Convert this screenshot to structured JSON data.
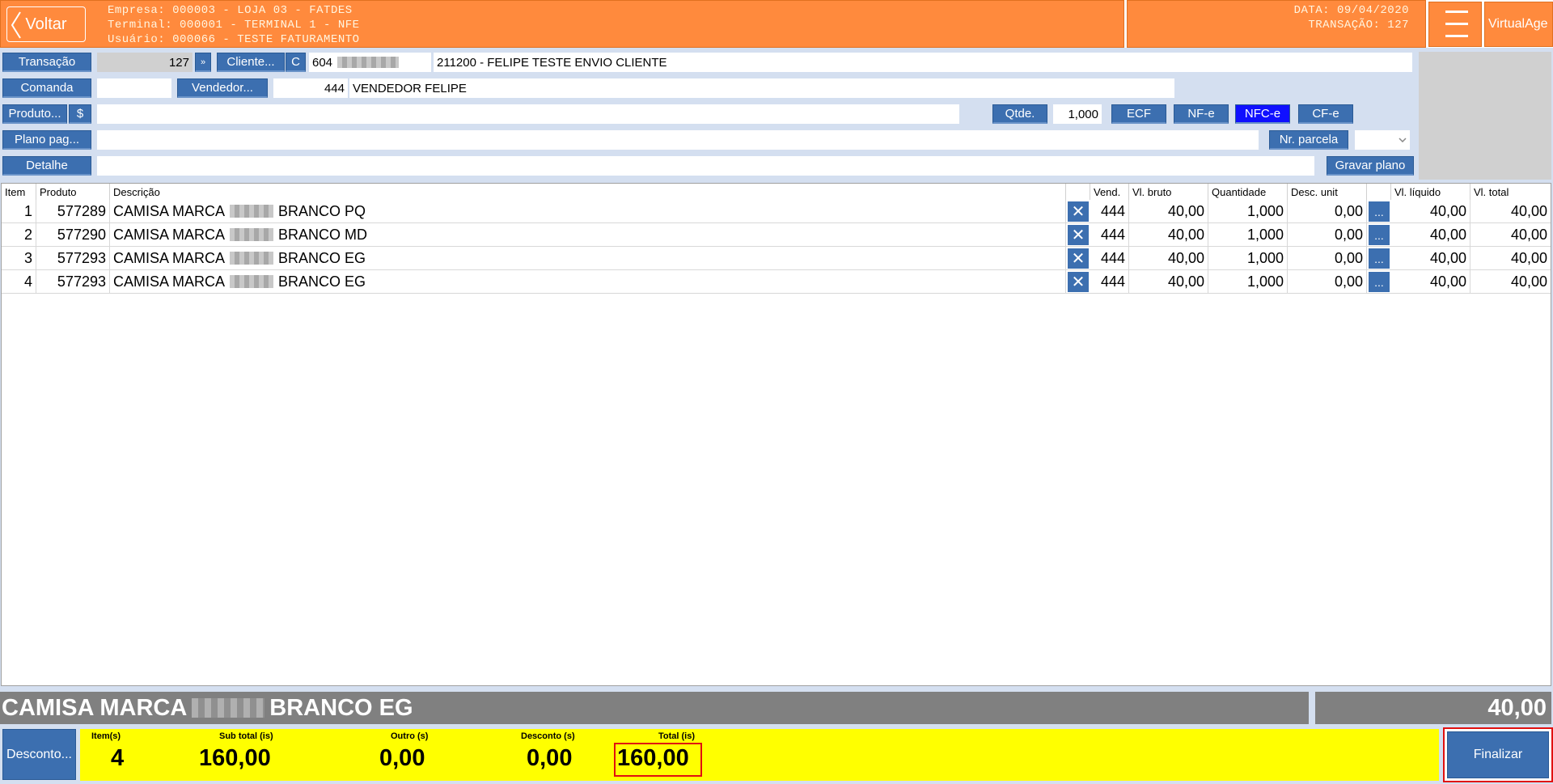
{
  "header": {
    "back_label": "Voltar",
    "empresa": "Empresa: 000003 - LOJA 03 - FATDES",
    "terminal": "Terminal: 000001 - TERMINAL 1 - NFE",
    "usuario": "Usuário: 000066 - TESTE FATURAMENTO",
    "data": "DATA: 09/04/2020",
    "transacao": "TRANSAÇÃO: 127",
    "virtualage_label": "VirtualAge",
    "brand_color": "#ff8a3d"
  },
  "form": {
    "transacao_label": "Transação",
    "transacao_value": "127",
    "arrow_label": "»",
    "cliente_label": "Cliente...",
    "cliente_c_label": "C",
    "cliente_code": "604",
    "cliente_name": "211200 - FELIPE TESTE ENVIO CLIENTE",
    "comanda_label": "Comanda",
    "vendedor_label": "Vendedor...",
    "vendedor_code": "444",
    "vendedor_name": "VENDEDOR FELIPE",
    "produto_label": "Produto...",
    "dollar_label": "$",
    "qtde_label": "Qtde.",
    "qtde_value": "1,000",
    "ecf_label": "ECF",
    "nfe_label": "NF-e",
    "nfce_label": "NFC-e",
    "cfe_label": "CF-e",
    "plano_label": "Plano pag...",
    "nr_parcela_label": "Nr. parcela",
    "detalhe_label": "Detalhe",
    "gravar_label": "Gravar plano",
    "selected_doc": "NFC-e"
  },
  "table": {
    "headers": [
      "Item",
      "Produto",
      "Descrição",
      "Vend.",
      "Vl. bruto",
      "Quantidade",
      "Desc. unit",
      "Vl. líquido",
      "Vl. total"
    ],
    "rows": [
      {
        "item": "1",
        "produto": "577289",
        "desc_a": "CAMISA MARCA",
        "desc_b": "BRANCO PQ",
        "vend": "444",
        "bruto": "40,00",
        "qtd": "1,000",
        "desc": "0,00",
        "liquido": "40,00",
        "total": "40,00"
      },
      {
        "item": "2",
        "produto": "577290",
        "desc_a": "CAMISA MARCA",
        "desc_b": "BRANCO MD",
        "vend": "444",
        "bruto": "40,00",
        "qtd": "1,000",
        "desc": "0,00",
        "liquido": "40,00",
        "total": "40,00"
      },
      {
        "item": "3",
        "produto": "577293",
        "desc_a": "CAMISA MARCA",
        "desc_b": "BRANCO EG",
        "vend": "444",
        "bruto": "40,00",
        "qtd": "1,000",
        "desc": "0,00",
        "liquido": "40,00",
        "total": "40,00"
      },
      {
        "item": "4",
        "produto": "577293",
        "desc_a": "CAMISA MARCA",
        "desc_b": "BRANCO EG",
        "vend": "444",
        "bruto": "40,00",
        "qtd": "1,000",
        "desc": "0,00",
        "liquido": "40,00",
        "total": "40,00"
      }
    ],
    "remove_icon": "close-icon",
    "more_label": "..."
  },
  "selected": {
    "desc_a": "CAMISA MARCA",
    "desc_b": "BRANCO EG",
    "value": "40,00"
  },
  "totals": {
    "desconto_btn": "Desconto...",
    "items_label": "Item(s)",
    "items_value": "4",
    "subtotal_label": "Sub total (is)",
    "subtotal_value": "160,00",
    "outro_label": "Outro (s)",
    "outro_value": "0,00",
    "desconto_label": "Desconto (s)",
    "desconto_value": "0,00",
    "total_label": "Total (is)",
    "total_value": "160,00",
    "finalizar_label": "Finalizar",
    "bar_color": "#ffff00",
    "highlight_color": "#e01010"
  }
}
